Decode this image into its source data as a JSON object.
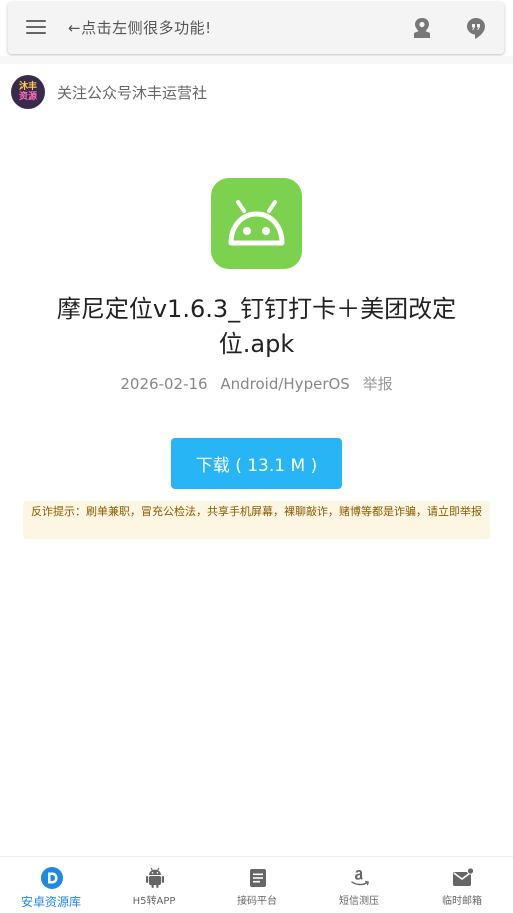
{
  "header": {
    "search_text": "←点击左侧很多功能!",
    "icons": [
      "menu-icon",
      "location-icon",
      "chat-icon"
    ]
  },
  "account": {
    "avatar_line1": "沐丰",
    "avatar_line2": "资源",
    "follow_text": "关注公众号沐丰运营社"
  },
  "app": {
    "icon": "android-icon",
    "icon_color": "#7cd24f",
    "title": "摩尼定位v1.6.3_钉钉打卡＋美团改定位.apk",
    "date": "2026-02-16",
    "platform": "Android/HyperOS",
    "report_label": "举报"
  },
  "download": {
    "label": "下载 ( 13.1 M )",
    "color": "#27b5f5"
  },
  "warning": {
    "text": "反诈提示：刷单兼职，冒充公检法，共享手机屏幕，裸聊敲诈，赌博等都是诈骗，请立即举报"
  },
  "bottom_nav": {
    "active_color": "#1e88e5",
    "items": [
      {
        "label": "安卓资源库",
        "icon": "d-logo-icon"
      },
      {
        "label": "H5转APP",
        "icon": "android-icon"
      },
      {
        "label": "接码平台",
        "icon": "document-icon"
      },
      {
        "label": "短信测压",
        "icon": "amazon-icon"
      },
      {
        "label": "临时邮箱",
        "icon": "mail-icon"
      }
    ]
  }
}
